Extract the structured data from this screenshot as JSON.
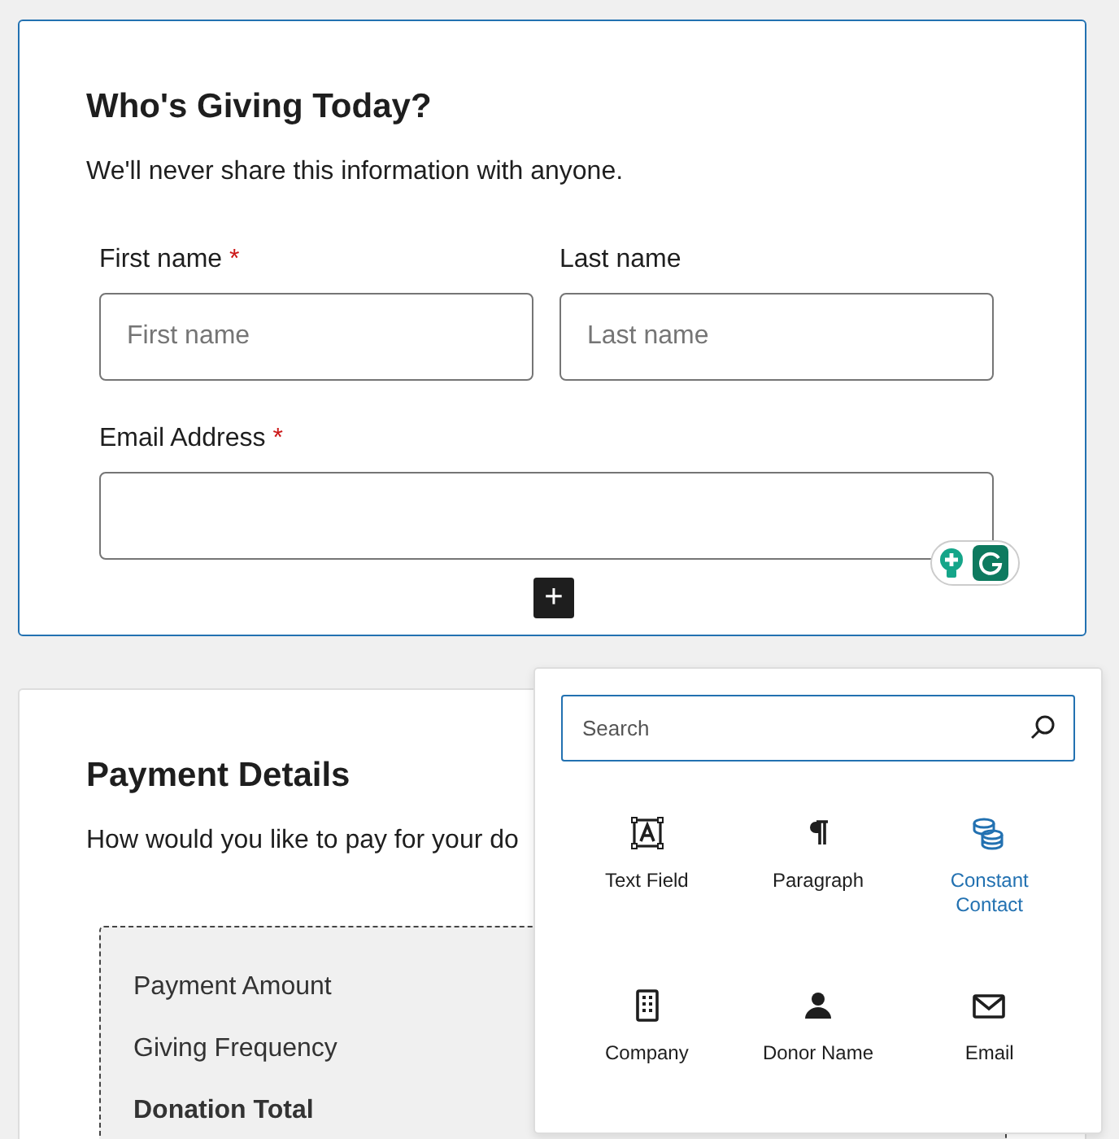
{
  "donor_section": {
    "title": "Who's Giving Today?",
    "description": "We'll never share this information with anyone.",
    "fields": [
      {
        "label": "First name",
        "required_mark": "*",
        "placeholder": "First name"
      },
      {
        "label": "Last name",
        "placeholder": "Last name"
      },
      {
        "label": "Email Address",
        "required_mark": "*"
      }
    ],
    "add_block_button": "+"
  },
  "payment_section": {
    "title": "Payment Details",
    "description": "How would you like to pay for your do",
    "summary_rows": [
      {
        "label": "Payment Amount",
        "bold": false
      },
      {
        "label": "Giving Frequency",
        "bold": false
      },
      {
        "label": "Donation Total",
        "bold": true
      }
    ]
  },
  "block_inserter": {
    "search": {
      "placeholder": "Search"
    },
    "blocks": [
      {
        "label": "Text Field",
        "kind": "text-field",
        "color": "#1e1e1e"
      },
      {
        "label": "Paragraph",
        "kind": "paragraph",
        "color": "#1e1e1e"
      },
      {
        "label": "Constant Contact",
        "kind": "coins",
        "color": "#2271b1"
      },
      {
        "label": "Company",
        "kind": "building",
        "color": "#1e1e1e"
      },
      {
        "label": "Donor Name",
        "kind": "person",
        "color": "#1e1e1e"
      },
      {
        "label": "Email",
        "kind": "envelope",
        "color": "#1e1e1e"
      }
    ]
  }
}
